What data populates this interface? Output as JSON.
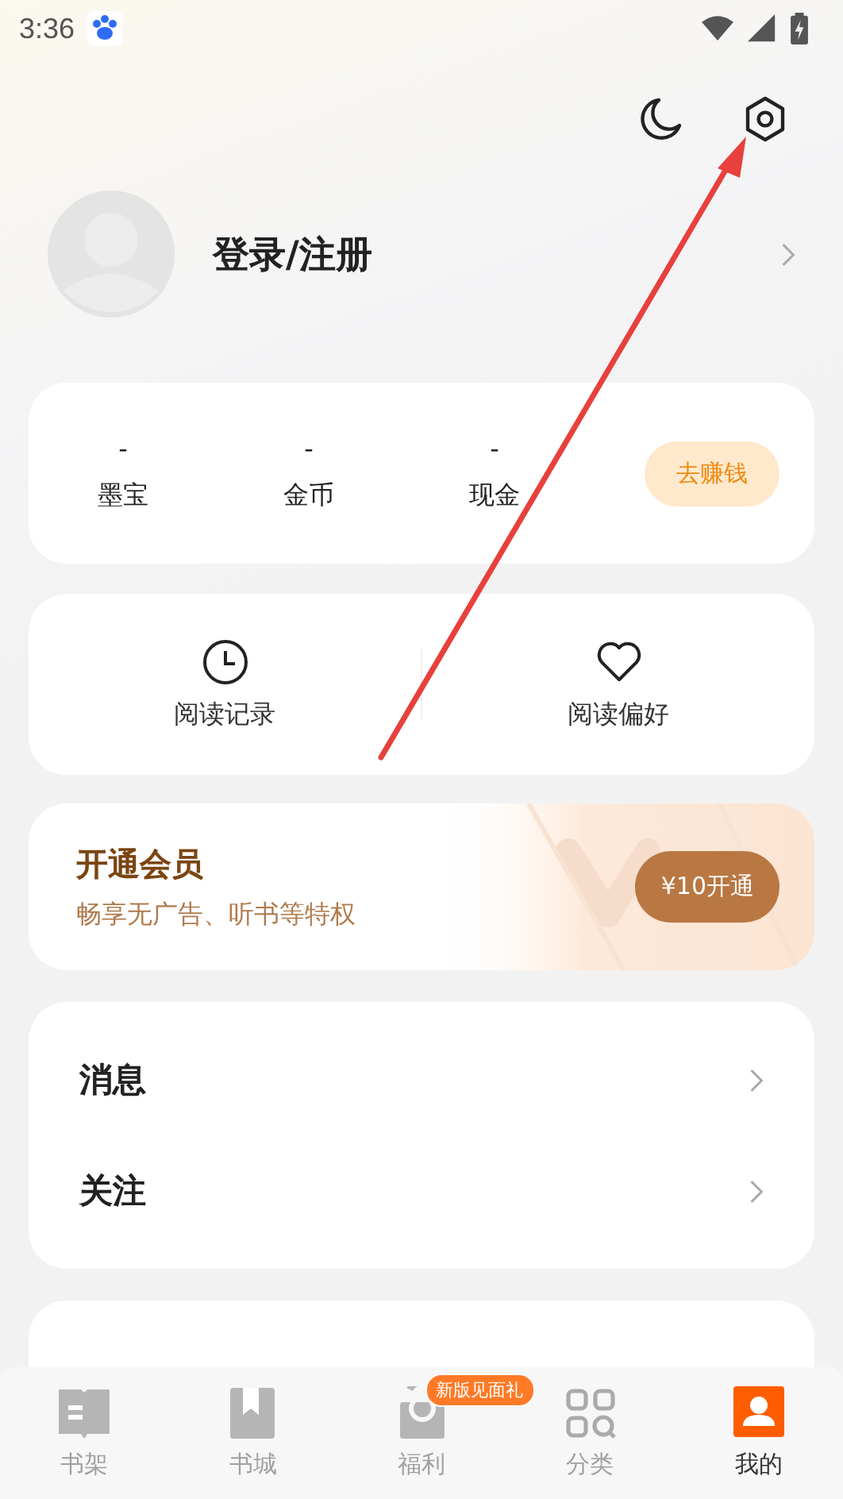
{
  "status_bar": {
    "time": "3:36"
  },
  "profile": {
    "name": "登录/注册"
  },
  "stats": {
    "items": [
      {
        "value": "-",
        "label": "墨宝"
      },
      {
        "value": "-",
        "label": "金币"
      },
      {
        "value": "-",
        "label": "现金"
      }
    ],
    "button": "去赚钱"
  },
  "shortcuts": [
    {
      "kind": "history",
      "label": "阅读记录"
    },
    {
      "kind": "heart",
      "label": "阅读偏好"
    }
  ],
  "vip": {
    "title": "开通会员",
    "subtitle": "畅享无广告、听书等特权",
    "button": "¥10开通"
  },
  "menu": [
    {
      "label": "消息"
    },
    {
      "label": "关注"
    }
  ],
  "bottom_nav": [
    {
      "kind": "shelf",
      "label": "书架",
      "selected": false
    },
    {
      "kind": "store",
      "label": "书城",
      "selected": false
    },
    {
      "kind": "gift",
      "label": "福利",
      "selected": false,
      "badge": "新版见面礼"
    },
    {
      "kind": "category",
      "label": "分类",
      "selected": false
    },
    {
      "kind": "me",
      "label": "我的",
      "selected": true
    }
  ]
}
